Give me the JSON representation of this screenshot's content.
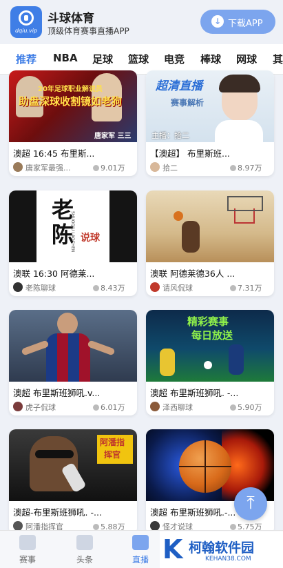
{
  "header": {
    "logo_domain": "dqiu.vip",
    "app_name": "斗球体育",
    "app_subtitle": "顶级体育赛事直播APP",
    "download_label": "下载APP"
  },
  "tabs": [
    "推荐",
    "NBA",
    "足球",
    "篮球",
    "电竞",
    "棒球",
    "网球",
    "其"
  ],
  "active_tab": 0,
  "cards": [
    {
      "title": "澳超 16:45 布里斯...",
      "author": "唐家军最强...",
      "views": "9.01万",
      "thumb_caption_1": "20年足球职业解说员",
      "thumb_caption_2": "助盘深球收割镜如老狗",
      "thumb_caption_3": "唐家军 三三"
    },
    {
      "title": "【澳超】 布里斯班...",
      "author": "拾二",
      "views": "8.97万",
      "thumb_caption_1": "超清直播",
      "thumb_caption_2": "赛事解析",
      "thumb_caption_3": "主播：拾二"
    },
    {
      "title": "澳联 16:30 阿德莱...",
      "author": "老陈聊球",
      "views": "8.43万",
      "thumb_caption_1": "老陈",
      "thumb_caption_2": "说球",
      "thumb_caption_3": "SHUOQIU LAOCHEN"
    },
    {
      "title": "澳联 阿德莱德36人 ...",
      "author": "请风侃球",
      "views": "7.31万"
    },
    {
      "title": "澳超 布里斯班狮吼.v...",
      "author": "虎子侃球",
      "views": "6.01万"
    },
    {
      "title": "澳超 布里斯班狮吼. -...",
      "author": "泽西聊球",
      "views": "5.90万",
      "thumb_caption_1": "精彩赛事",
      "thumb_caption_2": "每日放送"
    },
    {
      "title": "澳超-布里斯班狮吼. -...",
      "author": "阿潘指挥官",
      "views": "5.88万",
      "thumb_caption_1": "阿潘指",
      "thumb_caption_2": "挥官"
    },
    {
      "title": "澳超 布里斯班狮吼.-...",
      "author": "怪才说球",
      "views": "5.75万"
    }
  ],
  "bottom_nav": [
    "赛事",
    "头条",
    "直播"
  ],
  "active_nav": 2,
  "watermark": {
    "brand": "柯翰软件园",
    "url": "KEHAN38.COM"
  },
  "icons": {
    "download": "download-icon",
    "back_to_top": "arrow-up-icon"
  },
  "colors": {
    "accent": "#3f7ee6",
    "button": "#7ca5ee",
    "background": "#eef1f7"
  }
}
